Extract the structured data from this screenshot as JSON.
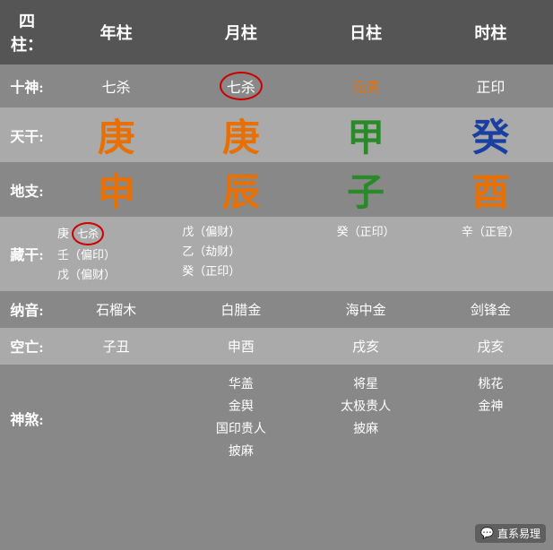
{
  "header": {
    "col0": "四柱：",
    "col1": "年柱",
    "col2": "月柱",
    "col3": "日柱",
    "col4": "时柱"
  },
  "rows": {
    "ten_god": {
      "label": "十神:",
      "year": "七杀",
      "month": "七杀",
      "day": "元男",
      "hour": "正印"
    },
    "tian_gan": {
      "label": "天干:",
      "year": "庚",
      "month": "庚",
      "day": "甲",
      "hour": "癸"
    },
    "di_zhi": {
      "label": "地支:",
      "year": "申",
      "month": "辰",
      "day": "子",
      "hour": "酉"
    },
    "cang_gan": {
      "label": "藏干:",
      "year": "庚（七杀）\n壬（偏印）\n戊（偏财）",
      "month": "戊（偏财）\n乙（劫财）\n癸（正印）",
      "day": "癸（正印）",
      "hour": "辛（正官）"
    },
    "na_yin": {
      "label": "纳音:",
      "year": "石榴木",
      "month": "白腊金",
      "day": "海中金",
      "hour": "剑锋金"
    },
    "kong_wang": {
      "label": "空亡:",
      "year": "子丑",
      "month": "申酉",
      "day": "戌亥",
      "hour": "戌亥"
    },
    "shen_sha": {
      "label": "神煞:",
      "year": "",
      "month": "华盖\n金舆\n国印贵人\n披麻",
      "day": "将星\n太极贵人\n披麻",
      "hour": "桃花\n金神"
    }
  },
  "watermark": {
    "icon": "💬",
    "text": "直系易理"
  }
}
